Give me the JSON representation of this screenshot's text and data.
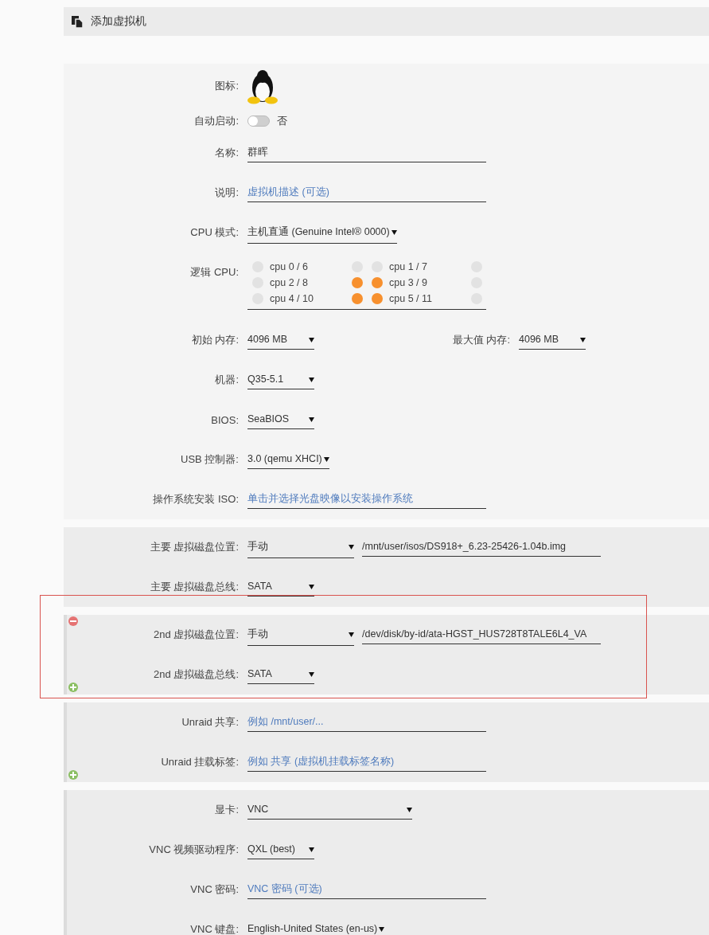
{
  "header": {
    "title": "添加虚拟机"
  },
  "sections": [
    {
      "kind": "main",
      "rows": [
        {
          "kind": "icon",
          "label": "图标:"
        },
        {
          "kind": "toggle",
          "label": "自动启动:",
          "on": false,
          "text": "否"
        },
        {
          "kind": "text",
          "label": "名称:",
          "value": "群晖"
        },
        {
          "kind": "text",
          "label": "说明:",
          "placeholder": "虚拟机描述 (可选)"
        },
        {
          "kind": "select",
          "label": "CPU 模式:",
          "value": "主机直通 (Genuine Intel® 0000)"
        },
        {
          "kind": "cpus",
          "label": "逻辑 CPU:",
          "cpus": [
            {
              "label": "cpu 0 / 6",
              "core_checked": false,
              "thread_checked": false
            },
            {
              "label": "cpu 1 / 7",
              "core_checked": false,
              "thread_checked": false
            },
            {
              "label": "cpu 2 / 8",
              "core_checked": false,
              "thread_checked": true
            },
            {
              "label": "cpu 3 / 9",
              "core_checked": true,
              "thread_checked": false
            },
            {
              "label": "cpu 4 / 10",
              "core_checked": false,
              "thread_checked": true
            },
            {
              "label": "cpu 5 / 11",
              "core_checked": true,
              "thread_checked": false
            }
          ]
        },
        {
          "kind": "pair",
          "label": "初始 内存:",
          "value": "4096 MB",
          "label_2": "最大值 内存:",
          "value_2": "4096 MB"
        },
        {
          "kind": "select",
          "label": "机器:",
          "value": "Q35-5.1"
        },
        {
          "kind": "select",
          "label": "BIOS:",
          "value": "SeaBIOS"
        },
        {
          "kind": "select",
          "label": "USB 控制器:",
          "value": "3.0 (qemu XHCI)"
        },
        {
          "kind": "text",
          "label": "操作系统安装 ISO:",
          "placeholder": "单击并选择光盘映像以安装操作系统"
        }
      ]
    },
    {
      "kind": "plain",
      "rows": [
        {
          "kind": "path",
          "label": "主要 虚拟磁盘位置:",
          "value": "手动",
          "path": "/mnt/user/isos/DS918+_6.23-25426-1.04b.img"
        },
        {
          "kind": "select",
          "label": "主要 虚拟磁盘总线:",
          "value": "SATA"
        }
      ]
    },
    {
      "kind": "group",
      "highlighted": true,
      "removable": true,
      "addable": true,
      "rows": [
        {
          "kind": "path",
          "label": "2nd 虚拟磁盘位置:",
          "value": "手动",
          "path": "/dev/disk/by-id/ata-HGST_HUS728T8TALE6L4_VA"
        },
        {
          "kind": "select",
          "label": "2nd 虚拟磁盘总线:",
          "value": "SATA"
        }
      ]
    },
    {
      "kind": "group",
      "addable": true,
      "rows": [
        {
          "kind": "text",
          "label": "Unraid 共享:",
          "placeholder": "例如 /mnt/user/..."
        },
        {
          "kind": "text",
          "label": "Unraid 挂载标签:",
          "placeholder": "例如 共享 (虚拟机挂载标签名称)"
        }
      ]
    },
    {
      "kind": "group",
      "rows": [
        {
          "kind": "wide-select",
          "label": "显卡:",
          "value": "VNC"
        },
        {
          "kind": "select",
          "label": "VNC 视频驱动程序:",
          "value": "QXL (best)"
        },
        {
          "kind": "text",
          "label": "VNC 密码:",
          "placeholder": "VNC 密码 (可选)"
        },
        {
          "kind": "select",
          "label": "VNC 键盘:",
          "value": "English-United States (en-us)"
        }
      ]
    }
  ]
}
